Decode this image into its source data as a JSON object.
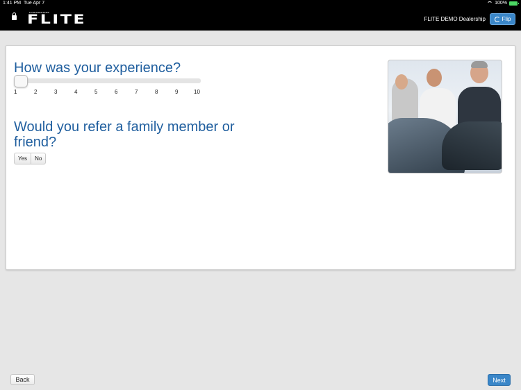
{
  "status_bar": {
    "time": "1:41 PM",
    "date": "Tue Apr 7",
    "battery": "100%",
    "wifi_icon": "wifi-icon",
    "battery_icon": "battery-icon"
  },
  "header": {
    "logo_small": "FUNDAMENTEMS",
    "logo": "FLITE",
    "dealership": "FLITE DEMO Dealership",
    "flip_label": "Flip",
    "flip_icon": "refresh-icon",
    "lock_icon": "lock-icon"
  },
  "survey": {
    "question1": "How was your experience?",
    "slider": {
      "ticks": [
        "1",
        "2",
        "3",
        "4",
        "5",
        "6",
        "7",
        "8",
        "9",
        "10"
      ],
      "value": 1
    },
    "question2": "Would you refer a family member or friend?",
    "yes_label": "Yes",
    "no_label": "No"
  },
  "footer": {
    "back_label": "Back",
    "next_label": "Next"
  },
  "colors": {
    "accent": "#3a86c8",
    "question_text": "#1f5e9e",
    "header_bg": "#000000",
    "page_bg": "#e6e6e6"
  }
}
